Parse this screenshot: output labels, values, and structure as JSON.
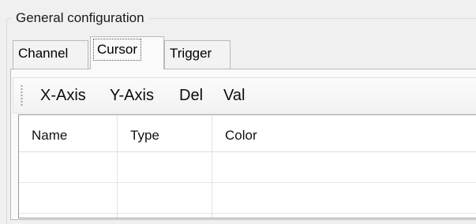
{
  "group": {
    "title": "General configuration"
  },
  "tabs": [
    {
      "label": "Channel",
      "active": false
    },
    {
      "label": "Cursor",
      "active": true
    },
    {
      "label": "Trigger",
      "active": false
    }
  ],
  "toolbar": {
    "buttons": [
      "X-Axis",
      "Y-Axis",
      "Del",
      "Val"
    ]
  },
  "grid": {
    "columns": [
      "Name",
      "Type",
      "Color"
    ],
    "rows": [
      [
        "",
        "",
        ""
      ],
      [
        "",
        "",
        ""
      ]
    ]
  }
}
